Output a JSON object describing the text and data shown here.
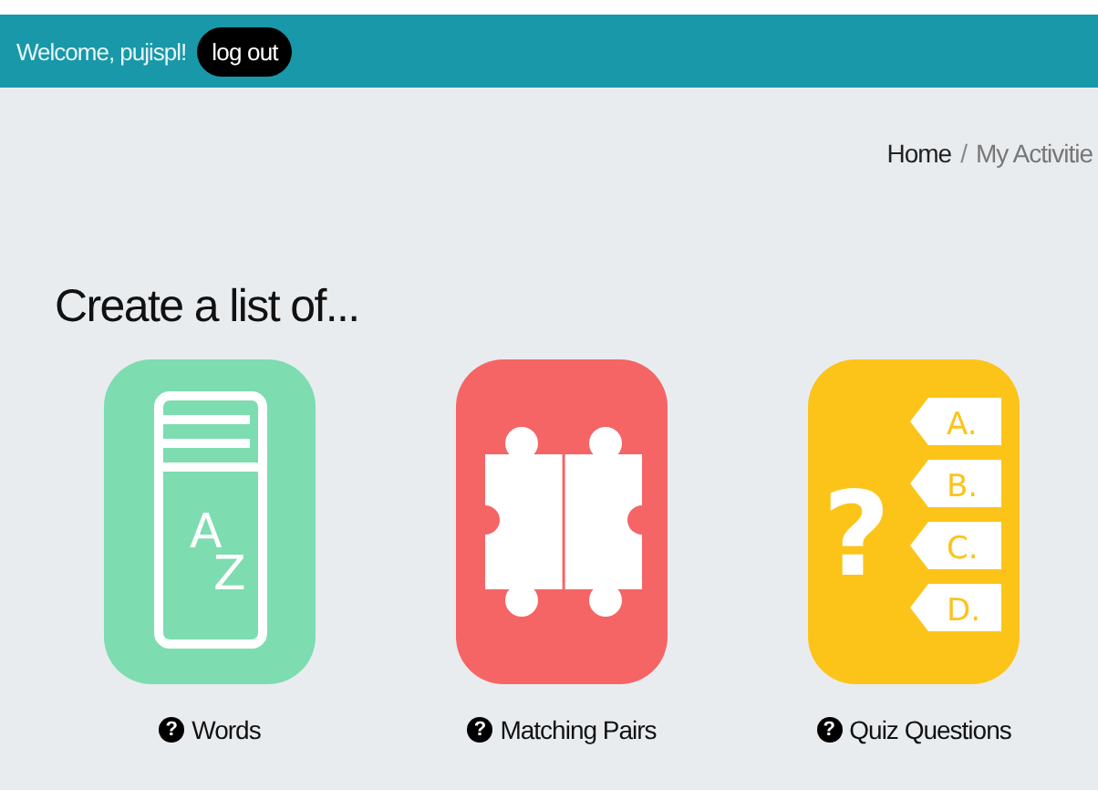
{
  "header": {
    "welcome": "Welcome, pujispl!",
    "logout": "log out"
  },
  "breadcrumb": [
    {
      "label": "Home",
      "selected": false
    },
    {
      "label": "My Activitie",
      "selected": true
    }
  ],
  "breadcrumb_separator": "/",
  "heading": "Create a list of...",
  "tiles": [
    {
      "kind": "book",
      "color": "#7ddcb0",
      "glyphs": [
        "A",
        "Z"
      ],
      "help": "?",
      "label": "Words"
    },
    {
      "kind": "puzzle",
      "color": "#f56565",
      "help": "?",
      "label": "Matching Pairs"
    },
    {
      "kind": "quiz",
      "color": "#fcc419",
      "glyphs": [
        "?",
        "A.",
        "B.",
        "C.",
        "D."
      ],
      "help": "?",
      "label": "Quiz Questions"
    }
  ]
}
